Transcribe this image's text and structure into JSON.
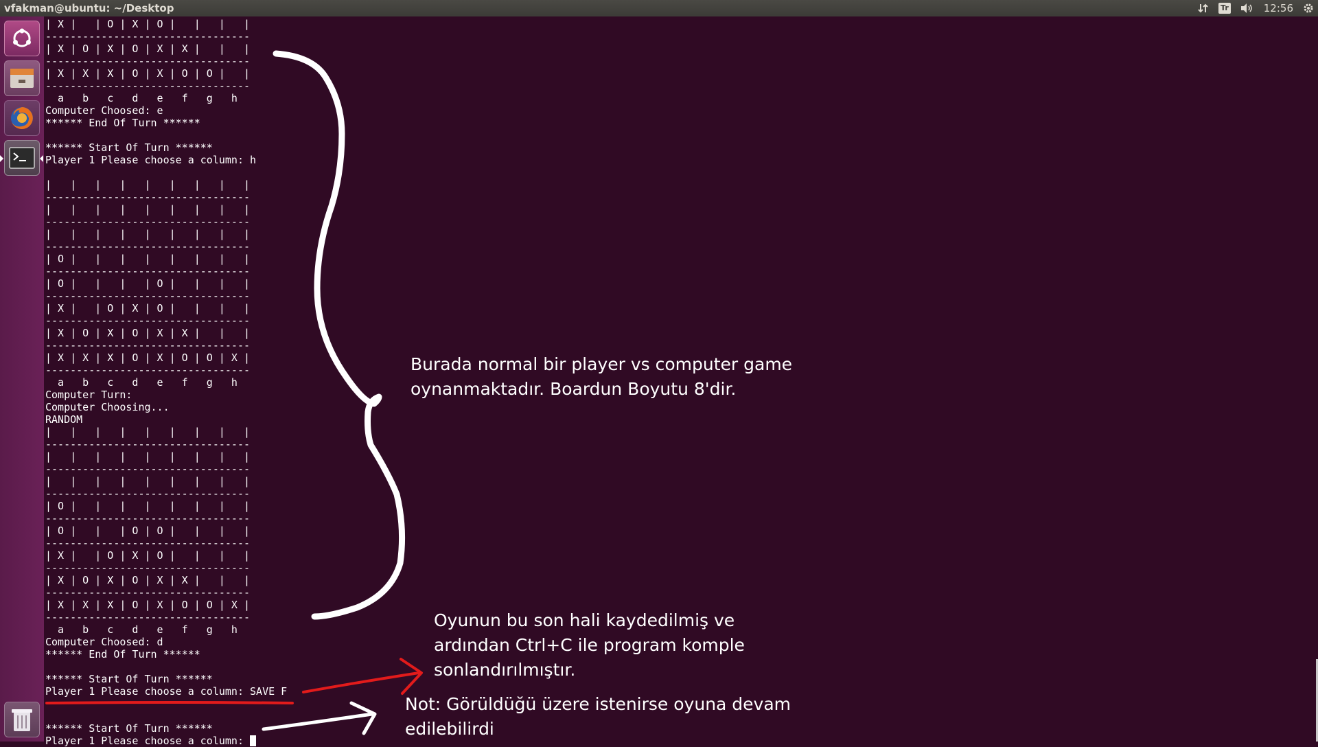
{
  "topbar": {
    "title": "vfakman@ubuntu: ~/Desktop",
    "keyboard_layout": "Tr",
    "clock": "12:56",
    "icons": [
      "network-arrows-icon",
      "keyboard-layout-icon",
      "volume-icon",
      "gear-icon"
    ]
  },
  "launcher": {
    "items": [
      {
        "name": "dash-home-icon"
      },
      {
        "name": "files-icon"
      },
      {
        "name": "firefox-icon"
      },
      {
        "name": "terminal-icon"
      },
      {
        "name": "trash-icon"
      }
    ]
  },
  "terminal": {
    "lines": [
      "| X |   | O | X | O |   |   |   |",
      "---------------------------------",
      "| X | O | X | O | X | X |   |   |",
      "---------------------------------",
      "| X | X | X | O | X | O | O |   |",
      "---------------------------------",
      "  a   b   c   d   e   f   g   h",
      "Computer Choosed: e",
      "****** End Of Turn ******",
      "",
      "****** Start Of Turn ******",
      "Player 1 Please choose a column: h",
      "",
      "|   |   |   |   |   |   |   |   |",
      "---------------------------------",
      "|   |   |   |   |   |   |   |   |",
      "---------------------------------",
      "|   |   |   |   |   |   |   |   |",
      "---------------------------------",
      "| O |   |   |   |   |   |   |   |",
      "---------------------------------",
      "| O |   |   |   | O |   |   |   |",
      "---------------------------------",
      "| X |   | O | X | O |   |   |   |",
      "---------------------------------",
      "| X | O | X | O | X | X |   |   |",
      "---------------------------------",
      "| X | X | X | O | X | O | O | X |",
      "---------------------------------",
      "  a   b   c   d   e   f   g   h",
      "Computer Turn:",
      "Computer Choosing...",
      "RANDOM",
      "|   |   |   |   |   |   |   |   |",
      "---------------------------------",
      "|   |   |   |   |   |   |   |   |",
      "---------------------------------",
      "|   |   |   |   |   |   |   |   |",
      "---------------------------------",
      "| O |   |   |   |   |   |   |   |",
      "---------------------------------",
      "| O |   |   | O | O |   |   |   |",
      "---------------------------------",
      "| X |   | O | X | O |   |   |   |",
      "---------------------------------",
      "| X | O | X | O | X | X |   |   |",
      "---------------------------------",
      "| X | X | X | O | X | O | O | X |",
      "---------------------------------",
      "  a   b   c   d   e   f   g   h",
      "Computer Choosed: d",
      "****** End Of Turn ******",
      "",
      "****** Start Of Turn ******",
      "Player 1 Please choose a column: SAVE F",
      "",
      "",
      "****** Start Of Turn ******"
    ],
    "prompt_line": "Player 1 Please choose a column: "
  },
  "annotations": {
    "note_1": "Burada normal bir player vs computer game\noynanmaktadır. Boardun Boyutu 8'dir.",
    "note_2": "Oyunun bu son hali kaydedilmiş ve\nardından Ctrl+C ile program komple\nsonlandırılmıştır.",
    "note_3": "Not: Görüldüğü üzere istenirse oyuna devam\nedilebilirdi",
    "colors": {
      "brace": "#ffffff",
      "red_mark": "#e21b1b",
      "white_arrow": "#ffffff"
    }
  }
}
